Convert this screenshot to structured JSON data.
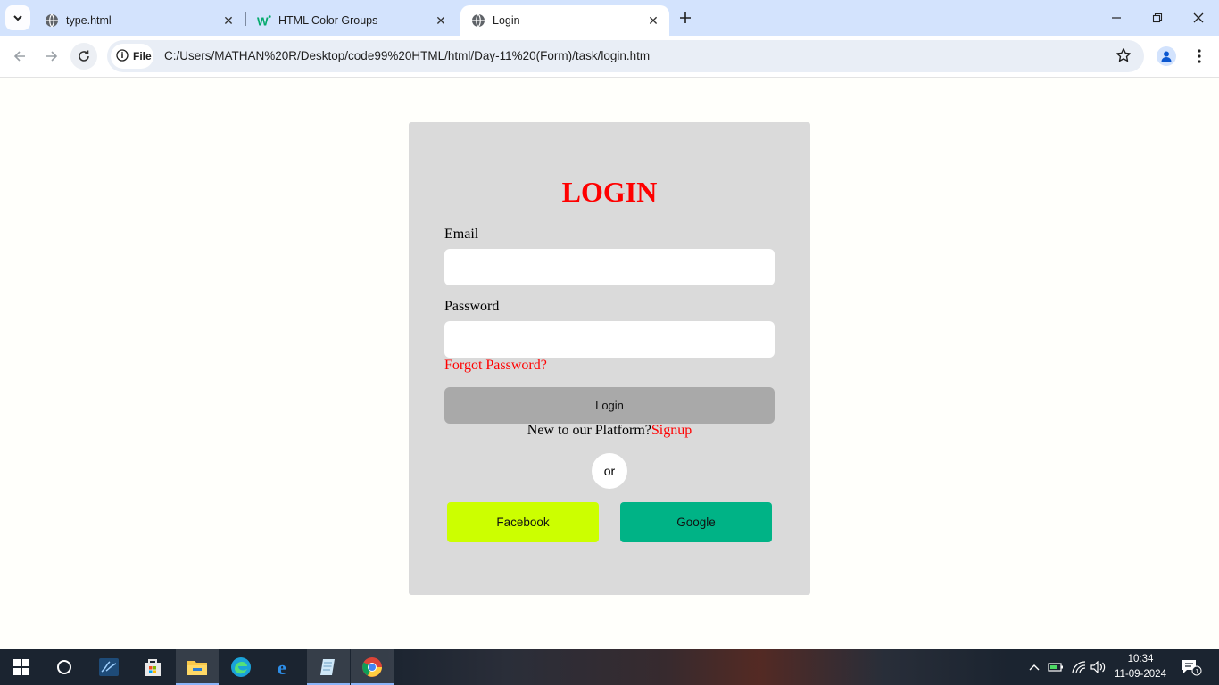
{
  "browser": {
    "tabs": [
      {
        "title": "type.html",
        "icon": "globe-icon"
      },
      {
        "title": "HTML Color Groups",
        "icon": "w3schools-icon"
      },
      {
        "title": "Login",
        "icon": "globe-icon",
        "active": true
      }
    ],
    "security_chip": "File",
    "url": "C:/Users/MATHAN%20R/Desktop/code99%20HTML/html/Day-11%20(Form)/task/login.htm"
  },
  "login": {
    "title": "LOGIN",
    "email_label": "Email",
    "email_value": "",
    "password_label": "Password",
    "password_value": "",
    "forgot": "Forgot Password?",
    "login_button": "Login",
    "new_text": "New to our Platform?",
    "signup": "Signup",
    "or": "or",
    "facebook": "Facebook",
    "google": "Google",
    "colors": {
      "title": "#ff0000",
      "card": "#dadada",
      "login_button": "#a9a9a9",
      "facebook": "#ccff00",
      "google": "#00b386"
    }
  },
  "taskbar": {
    "time": "10:34",
    "date": "11-09-2024",
    "notification_count": "1"
  }
}
